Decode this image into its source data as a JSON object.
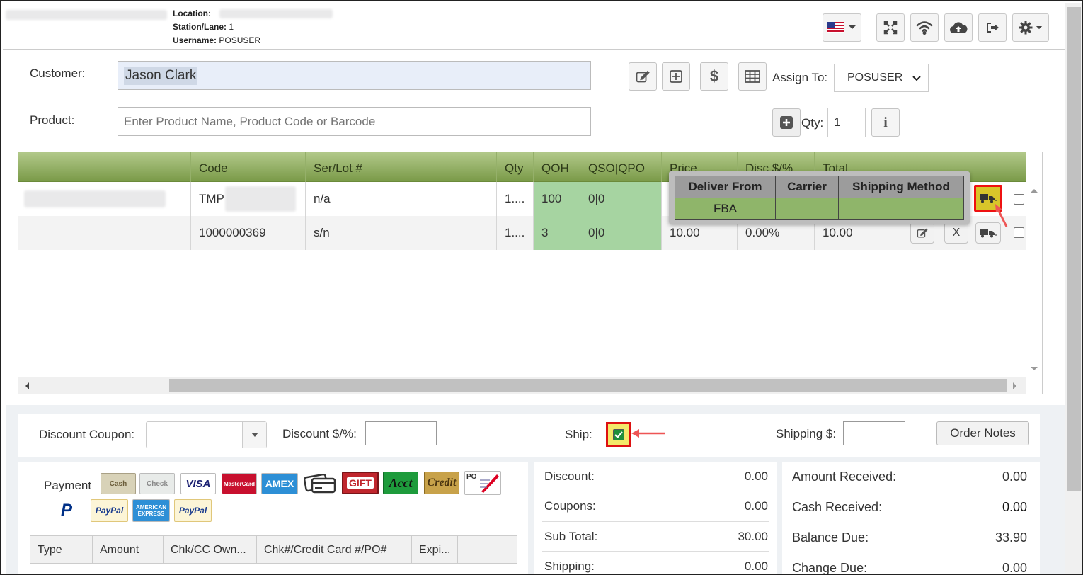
{
  "header": {
    "location_label": "Location:",
    "station_label": "Station/Lane:",
    "station_value": "1",
    "username_label": "Username:",
    "username_value": "POSUSER",
    "icons": [
      "us-flag-icon",
      "fullscreen-icon",
      "wifi-icon",
      "cloud-upload-icon",
      "logout-icon",
      "gear-icon"
    ]
  },
  "customer": {
    "label": "Customer:",
    "value": "Jason Clark",
    "assign_label": "Assign To:",
    "assign_value": "POSUSER"
  },
  "product": {
    "label": "Product:",
    "placeholder": "Enter Product Name, Product Code or Barcode",
    "qty_label": "Qty:",
    "qty_value": "1"
  },
  "grid": {
    "columns": [
      "Code",
      "Ser/Lot #",
      "Qty",
      "QOH",
      "QSO|QPO",
      "Price",
      "Disc $/%",
      "Total"
    ],
    "rows": [
      {
        "code": "TMP",
        "serlot": "n/a",
        "qty": "1....",
        "qoh": "100",
        "qso": "0|0",
        "price": "",
        "disc": "",
        "total": ""
      },
      {
        "code": "1000000369",
        "serlot": "s/n",
        "qty": "1....",
        "qoh": "3",
        "qso": "0|0",
        "price": "10.00",
        "disc": "0.00%",
        "total": "10.00",
        "delete": "X"
      }
    ]
  },
  "ship_popup": {
    "headers": [
      "Deliver From",
      "Carrier",
      "Shipping Method"
    ],
    "values": [
      "FBA",
      "",
      ""
    ]
  },
  "options": {
    "coupon_label": "Discount Coupon:",
    "discount_label": "Discount $/%:",
    "ship_label": "Ship:",
    "shipping_label": "Shipping $:",
    "order_notes": "Order Notes"
  },
  "payment": {
    "label": "Payment",
    "methods": [
      "Cash",
      "Check",
      "VISA",
      "MasterCard",
      "AMEX",
      "Card",
      "GIFT",
      "Acct",
      "Credit",
      "PO",
      "P",
      "PayPal",
      "AMERICAN EXPRESS",
      "PayPal"
    ],
    "table_headers": [
      "Type",
      "Amount",
      "Chk/CC Own...",
      "Chk#/Credit Card #/PO#",
      "Expi..."
    ]
  },
  "totals": {
    "discount_label": "Discount:",
    "discount": "0.00",
    "coupons_label": "Coupons:",
    "coupons": "0.00",
    "subtotal_label": "Sub Total:",
    "subtotal": "30.00",
    "shipping_label": "Shipping:",
    "shipping": "0.00"
  },
  "received": {
    "amount_label": "Amount Received:",
    "amount": "0.00",
    "cash_label": "Cash Received:",
    "cash": "0.00",
    "balance_label": "Balance Due:",
    "balance": "33.90",
    "change_label": "Change Due:",
    "change": "0.00"
  }
}
